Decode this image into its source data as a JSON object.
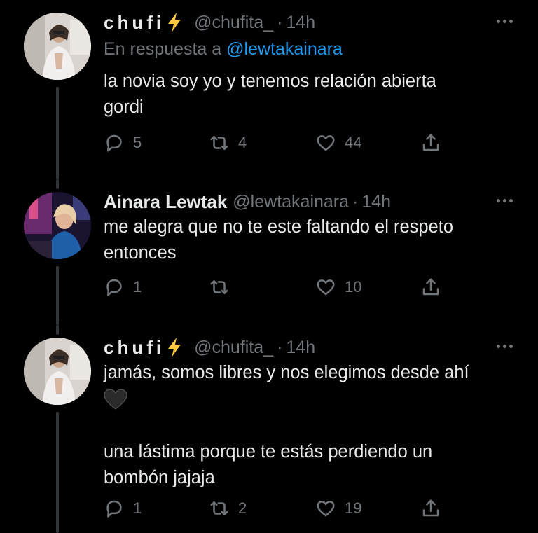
{
  "tweets": [
    {
      "name": "chufi",
      "handle": "@chufita_",
      "dot": "·",
      "time": "14h",
      "reply_prefix": "En respuesta a",
      "reply_mention": "@lewtakainara",
      "text_lines": [
        "la novia soy yo y tenemos relación abierta",
        "gordi"
      ],
      "replies": "5",
      "retweets": "4",
      "likes": "44"
    },
    {
      "name": "Ainara Lewtak",
      "handle": "@lewtakainara",
      "dot": "·",
      "time": "14h",
      "text_lines": [
        "me alegra que no te este faltando el respeto",
        "entonces"
      ],
      "replies": "1",
      "retweets": "",
      "likes": "10"
    },
    {
      "name": "chufi",
      "handle": "@chufita_",
      "dot": "·",
      "time": "14h",
      "text_line1": "jamás, somos libres y nos elegimos desde ahí",
      "text_lines2": [
        "una lástima porque te estás perdiendo un",
        "bombón jajaja"
      ],
      "replies": "1",
      "retweets": "2",
      "likes": "19"
    }
  ],
  "icons": {
    "bolt": "lightning-bolt-emoji",
    "heart": "black-heart-emoji",
    "reply": "reply-icon",
    "retweet": "retweet-icon",
    "like": "like-icon",
    "share": "share-icon",
    "more": "more-icon"
  },
  "colors": {
    "background": "#000000",
    "text": "#e7e9ea",
    "secondary": "#71767b",
    "link": "#1d9bf0",
    "bolt": "#ffc83d"
  }
}
